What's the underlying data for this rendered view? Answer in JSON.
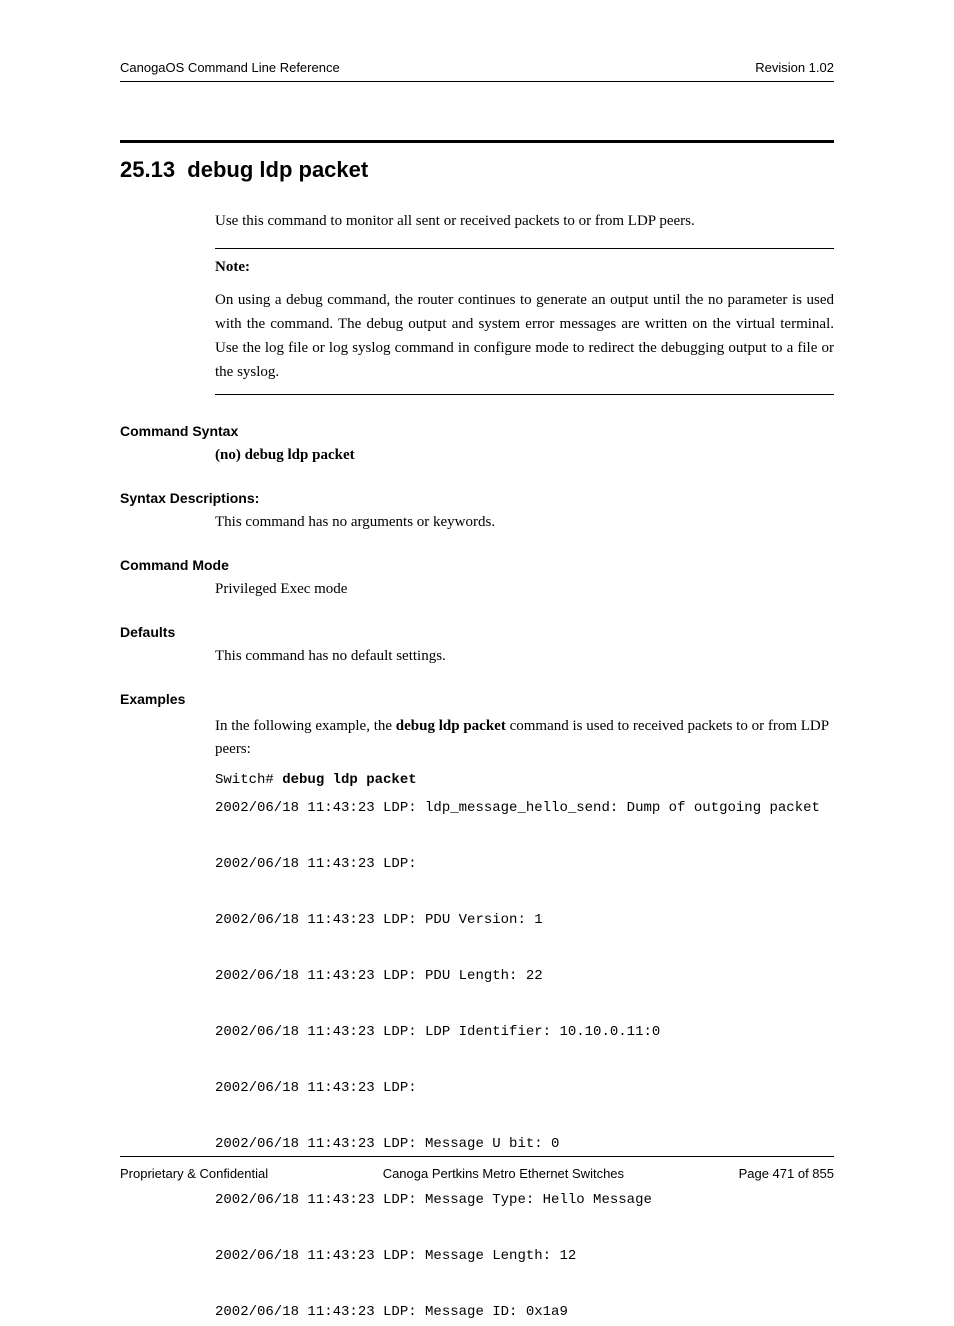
{
  "header": {
    "left": "CanogaOS Command Line Reference",
    "right": "Revision 1.02"
  },
  "section": {
    "number": "25.13",
    "title": "debug ldp packet"
  },
  "intro": "Use this command to monitor all sent or received packets to or from LDP peers.",
  "note": {
    "label": "Note:",
    "text": "On using a debug command, the router continues to generate an output until the no parameter is used with the command. The debug output and system error messages are written on the virtual terminal. Use the log file or log syslog command in configure mode to redirect the debugging output to a file or the syslog."
  },
  "command_syntax": {
    "heading": "Command Syntax",
    "value": "(no) debug ldp packet"
  },
  "syntax_descriptions": {
    "heading": "Syntax Descriptions:",
    "value": "This command has no arguments or keywords."
  },
  "command_mode": {
    "heading": "Command Mode",
    "value": "Privileged Exec mode"
  },
  "defaults": {
    "heading": "Defaults",
    "value": "This command has no default settings."
  },
  "examples": {
    "heading": "Examples",
    "intro_prefix": "In the following example, the ",
    "intro_bold": "debug ldp packet",
    "intro_suffix": " command is used to received packets to or from LDP peers:",
    "prompt": "Switch# ",
    "command": "debug ldp packet",
    "output": [
      "2002/06/18 11:43:23 LDP: ldp_message_hello_send: Dump of outgoing packet",
      "2002/06/18 11:43:23 LDP:",
      "2002/06/18 11:43:23 LDP: PDU Version: 1",
      "2002/06/18 11:43:23 LDP: PDU Length: 22",
      "2002/06/18 11:43:23 LDP: LDP Identifier: 10.10.0.11:0",
      "2002/06/18 11:43:23 LDP:",
      "2002/06/18 11:43:23 LDP: Message U bit: 0",
      "2002/06/18 11:43:23 LDP: Message Type: Hello Message",
      "2002/06/18 11:43:23 LDP: Message Length: 12",
      "2002/06/18 11:43:23 LDP: Message ID: 0x1a9"
    ]
  },
  "footer": {
    "left": "Proprietary & Confidential",
    "center": "Canoga Pertkins Metro Ethernet Switches",
    "right": "Page 471 of 855"
  }
}
